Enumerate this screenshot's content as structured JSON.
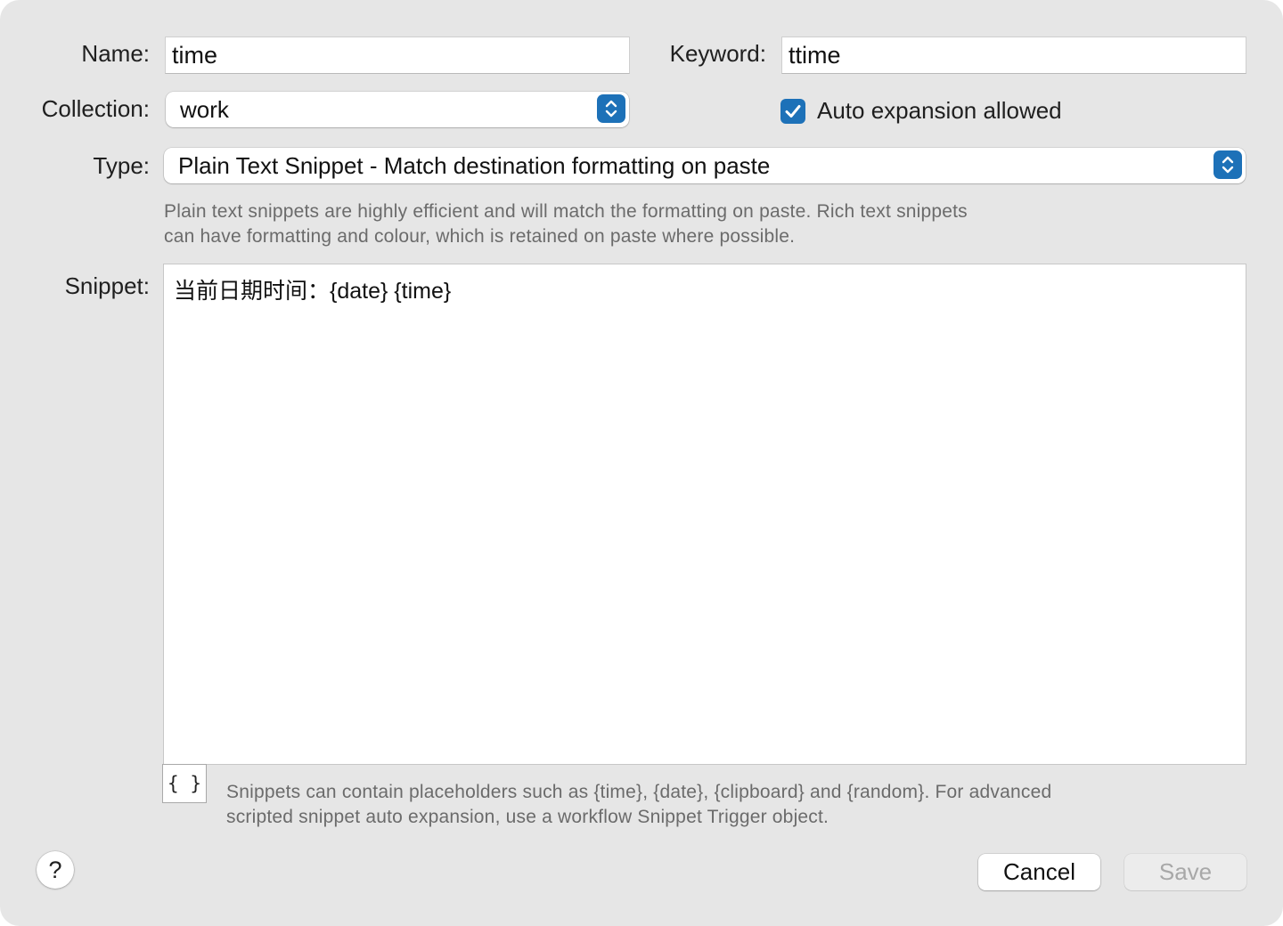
{
  "form": {
    "name_label": "Name:",
    "name_value": "time",
    "keyword_label": "Keyword:",
    "keyword_value": "ttime",
    "collection_label": "Collection:",
    "collection_value": "work",
    "auto_expansion_label": "Auto expansion allowed",
    "auto_expansion_checked": true,
    "type_label": "Type:",
    "type_value": "Plain Text Snippet - Match destination formatting on paste",
    "type_help_line1": "Plain text snippets are highly efficient and will match the formatting on paste. Rich text snippets",
    "type_help_line2": "can have formatting and colour, which is retained on paste where possible.",
    "snippet_label": "Snippet:",
    "snippet_value": "当前日期时间：{date} {time}",
    "placeholder_button_label": "{ }",
    "snippet_help_line1": "Snippets can contain placeholders such as {time}, {date}, {clipboard} and {random}. For advanced",
    "snippet_help_line2": "scripted snippet auto expansion, use a workflow Snippet Trigger object."
  },
  "footer": {
    "help_label": "?",
    "cancel_label": "Cancel",
    "save_label": "Save"
  },
  "colors": {
    "accent": "#1d71b8",
    "dialog_background": "#e6e6e6"
  },
  "icons": {
    "stepper": "chevron-up-down-icon",
    "checkbox": "checkmark-icon"
  }
}
